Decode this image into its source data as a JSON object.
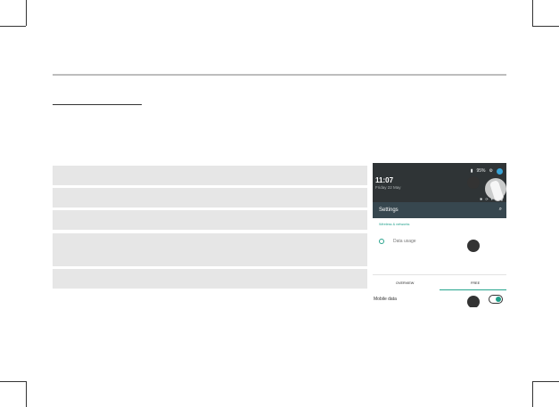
{
  "phone": {
    "status": {
      "battery_text": "95%",
      "icons": [
        "battery-icon",
        "gear-icon",
        "account-icon"
      ]
    },
    "notification": {
      "time": "11:07",
      "date": "Friday 22 May"
    },
    "settings": {
      "title": "Settings",
      "section": "Wireless & networks",
      "item": "Data usage"
    },
    "tabs": [
      "OVERVIEW",
      "FREE"
    ],
    "mobile_data_label": "Mobile data",
    "toggle_state": true,
    "colors": {
      "accent": "#20a08c",
      "dark": "#2f3436"
    }
  }
}
